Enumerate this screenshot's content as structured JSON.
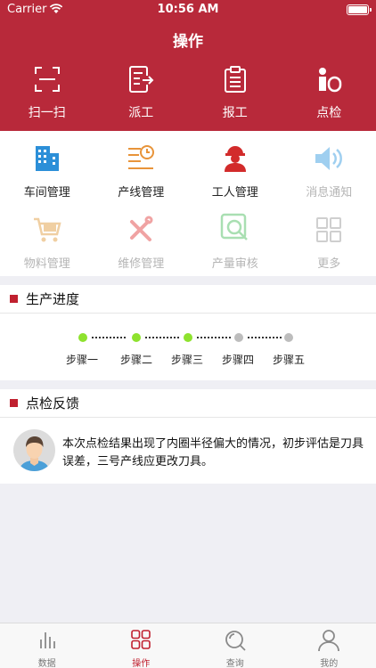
{
  "status": {
    "carrier": "Carrier",
    "time": "10:56 AM"
  },
  "nav": {
    "title": "操作"
  },
  "top_actions": [
    {
      "label": "扫一扫",
      "icon": "scan-icon"
    },
    {
      "label": "派工",
      "icon": "dispatch-icon"
    },
    {
      "label": "报工",
      "icon": "clipboard-icon"
    },
    {
      "label": "点检",
      "icon": "info-icon"
    }
  ],
  "grid": [
    {
      "label": "车间管理",
      "icon": "building-icon",
      "enabled": true
    },
    {
      "label": "产线管理",
      "icon": "production-line-icon",
      "enabled": true
    },
    {
      "label": "工人管理",
      "icon": "worker-icon",
      "enabled": true
    },
    {
      "label": "消息通知",
      "icon": "speaker-icon",
      "enabled": false
    },
    {
      "label": "物料管理",
      "icon": "cart-icon",
      "enabled": false
    },
    {
      "label": "维修管理",
      "icon": "tools-icon",
      "enabled": false
    },
    {
      "label": "产量审核",
      "icon": "magnifier-icon",
      "enabled": false
    },
    {
      "label": "更多",
      "icon": "more-grid-icon",
      "enabled": false
    }
  ],
  "progress": {
    "title": "生产进度",
    "steps": [
      {
        "label": "步骤一",
        "done": true
      },
      {
        "label": "步骤二",
        "done": true
      },
      {
        "label": "步骤三",
        "done": true
      },
      {
        "label": "步骤四",
        "done": false
      },
      {
        "label": "步骤五",
        "done": false
      }
    ]
  },
  "feedback": {
    "title": "点检反馈",
    "text": "本次点检结果出现了内圈半径偏大的情况，初步评估是刀具误差，三号产线应更改刀具。"
  },
  "tabs": [
    {
      "label": "数据",
      "icon": "chart-icon",
      "active": false
    },
    {
      "label": "操作",
      "icon": "grid-icon",
      "active": true
    },
    {
      "label": "查询",
      "icon": "search-icon",
      "active": false
    },
    {
      "label": "我的",
      "icon": "user-icon",
      "active": false
    }
  ],
  "colors": {
    "brand": "#b8293a",
    "step_done": "#8ee22e",
    "step_todo": "#bdbdbd"
  }
}
